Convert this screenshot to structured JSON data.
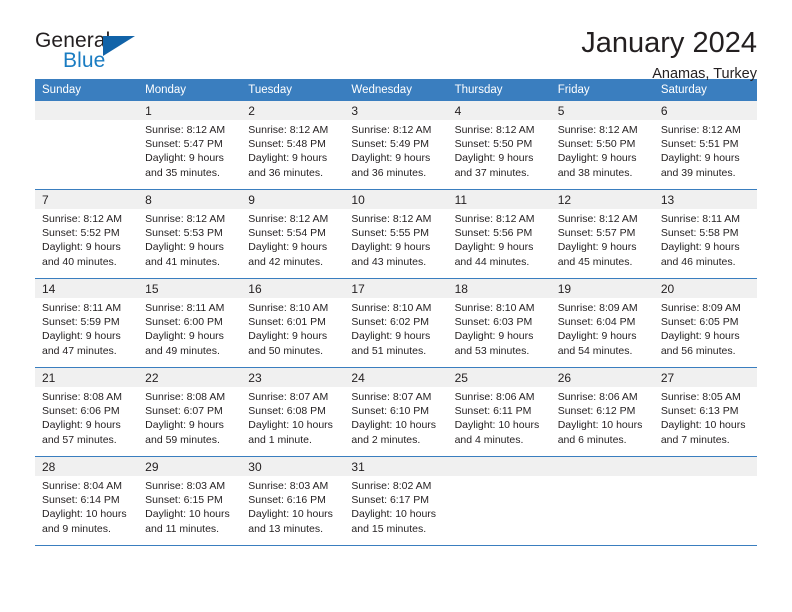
{
  "brand": {
    "name_part1": "General",
    "name_part2": "Blue",
    "accent_color": "#1163a8",
    "blue_text_color": "#1a7cc2"
  },
  "header": {
    "title": "January 2024",
    "subtitle": "Anamas, Turkey",
    "header_bg_color": "#3a7ebf",
    "daynum_bg_color": "#f0f0f0"
  },
  "weekdays": [
    "Sunday",
    "Monday",
    "Tuesday",
    "Wednesday",
    "Thursday",
    "Friday",
    "Saturday"
  ],
  "weeks": [
    {
      "days": [
        {
          "num": "",
          "sunrise": "",
          "sunset": "",
          "daylight1": "",
          "daylight2": "",
          "empty": true
        },
        {
          "num": "1",
          "sunrise": "Sunrise: 8:12 AM",
          "sunset": "Sunset: 5:47 PM",
          "daylight1": "Daylight: 9 hours",
          "daylight2": "and 35 minutes."
        },
        {
          "num": "2",
          "sunrise": "Sunrise: 8:12 AM",
          "sunset": "Sunset: 5:48 PM",
          "daylight1": "Daylight: 9 hours",
          "daylight2": "and 36 minutes."
        },
        {
          "num": "3",
          "sunrise": "Sunrise: 8:12 AM",
          "sunset": "Sunset: 5:49 PM",
          "daylight1": "Daylight: 9 hours",
          "daylight2": "and 36 minutes."
        },
        {
          "num": "4",
          "sunrise": "Sunrise: 8:12 AM",
          "sunset": "Sunset: 5:50 PM",
          "daylight1": "Daylight: 9 hours",
          "daylight2": "and 37 minutes."
        },
        {
          "num": "5",
          "sunrise": "Sunrise: 8:12 AM",
          "sunset": "Sunset: 5:50 PM",
          "daylight1": "Daylight: 9 hours",
          "daylight2": "and 38 minutes."
        },
        {
          "num": "6",
          "sunrise": "Sunrise: 8:12 AM",
          "sunset": "Sunset: 5:51 PM",
          "daylight1": "Daylight: 9 hours",
          "daylight2": "and 39 minutes."
        }
      ]
    },
    {
      "days": [
        {
          "num": "7",
          "sunrise": "Sunrise: 8:12 AM",
          "sunset": "Sunset: 5:52 PM",
          "daylight1": "Daylight: 9 hours",
          "daylight2": "and 40 minutes."
        },
        {
          "num": "8",
          "sunrise": "Sunrise: 8:12 AM",
          "sunset": "Sunset: 5:53 PM",
          "daylight1": "Daylight: 9 hours",
          "daylight2": "and 41 minutes."
        },
        {
          "num": "9",
          "sunrise": "Sunrise: 8:12 AM",
          "sunset": "Sunset: 5:54 PM",
          "daylight1": "Daylight: 9 hours",
          "daylight2": "and 42 minutes."
        },
        {
          "num": "10",
          "sunrise": "Sunrise: 8:12 AM",
          "sunset": "Sunset: 5:55 PM",
          "daylight1": "Daylight: 9 hours",
          "daylight2": "and 43 minutes."
        },
        {
          "num": "11",
          "sunrise": "Sunrise: 8:12 AM",
          "sunset": "Sunset: 5:56 PM",
          "daylight1": "Daylight: 9 hours",
          "daylight2": "and 44 minutes."
        },
        {
          "num": "12",
          "sunrise": "Sunrise: 8:12 AM",
          "sunset": "Sunset: 5:57 PM",
          "daylight1": "Daylight: 9 hours",
          "daylight2": "and 45 minutes."
        },
        {
          "num": "13",
          "sunrise": "Sunrise: 8:11 AM",
          "sunset": "Sunset: 5:58 PM",
          "daylight1": "Daylight: 9 hours",
          "daylight2": "and 46 minutes."
        }
      ]
    },
    {
      "days": [
        {
          "num": "14",
          "sunrise": "Sunrise: 8:11 AM",
          "sunset": "Sunset: 5:59 PM",
          "daylight1": "Daylight: 9 hours",
          "daylight2": "and 47 minutes."
        },
        {
          "num": "15",
          "sunrise": "Sunrise: 8:11 AM",
          "sunset": "Sunset: 6:00 PM",
          "daylight1": "Daylight: 9 hours",
          "daylight2": "and 49 minutes."
        },
        {
          "num": "16",
          "sunrise": "Sunrise: 8:10 AM",
          "sunset": "Sunset: 6:01 PM",
          "daylight1": "Daylight: 9 hours",
          "daylight2": "and 50 minutes."
        },
        {
          "num": "17",
          "sunrise": "Sunrise: 8:10 AM",
          "sunset": "Sunset: 6:02 PM",
          "daylight1": "Daylight: 9 hours",
          "daylight2": "and 51 minutes."
        },
        {
          "num": "18",
          "sunrise": "Sunrise: 8:10 AM",
          "sunset": "Sunset: 6:03 PM",
          "daylight1": "Daylight: 9 hours",
          "daylight2": "and 53 minutes."
        },
        {
          "num": "19",
          "sunrise": "Sunrise: 8:09 AM",
          "sunset": "Sunset: 6:04 PM",
          "daylight1": "Daylight: 9 hours",
          "daylight2": "and 54 minutes."
        },
        {
          "num": "20",
          "sunrise": "Sunrise: 8:09 AM",
          "sunset": "Sunset: 6:05 PM",
          "daylight1": "Daylight: 9 hours",
          "daylight2": "and 56 minutes."
        }
      ]
    },
    {
      "days": [
        {
          "num": "21",
          "sunrise": "Sunrise: 8:08 AM",
          "sunset": "Sunset: 6:06 PM",
          "daylight1": "Daylight: 9 hours",
          "daylight2": "and 57 minutes."
        },
        {
          "num": "22",
          "sunrise": "Sunrise: 8:08 AM",
          "sunset": "Sunset: 6:07 PM",
          "daylight1": "Daylight: 9 hours",
          "daylight2": "and 59 minutes."
        },
        {
          "num": "23",
          "sunrise": "Sunrise: 8:07 AM",
          "sunset": "Sunset: 6:08 PM",
          "daylight1": "Daylight: 10 hours",
          "daylight2": "and 1 minute."
        },
        {
          "num": "24",
          "sunrise": "Sunrise: 8:07 AM",
          "sunset": "Sunset: 6:10 PM",
          "daylight1": "Daylight: 10 hours",
          "daylight2": "and 2 minutes."
        },
        {
          "num": "25",
          "sunrise": "Sunrise: 8:06 AM",
          "sunset": "Sunset: 6:11 PM",
          "daylight1": "Daylight: 10 hours",
          "daylight2": "and 4 minutes."
        },
        {
          "num": "26",
          "sunrise": "Sunrise: 8:06 AM",
          "sunset": "Sunset: 6:12 PM",
          "daylight1": "Daylight: 10 hours",
          "daylight2": "and 6 minutes."
        },
        {
          "num": "27",
          "sunrise": "Sunrise: 8:05 AM",
          "sunset": "Sunset: 6:13 PM",
          "daylight1": "Daylight: 10 hours",
          "daylight2": "and 7 minutes."
        }
      ]
    },
    {
      "days": [
        {
          "num": "28",
          "sunrise": "Sunrise: 8:04 AM",
          "sunset": "Sunset: 6:14 PM",
          "daylight1": "Daylight: 10 hours",
          "daylight2": "and 9 minutes."
        },
        {
          "num": "29",
          "sunrise": "Sunrise: 8:03 AM",
          "sunset": "Sunset: 6:15 PM",
          "daylight1": "Daylight: 10 hours",
          "daylight2": "and 11 minutes."
        },
        {
          "num": "30",
          "sunrise": "Sunrise: 8:03 AM",
          "sunset": "Sunset: 6:16 PM",
          "daylight1": "Daylight: 10 hours",
          "daylight2": "and 13 minutes."
        },
        {
          "num": "31",
          "sunrise": "Sunrise: 8:02 AM",
          "sunset": "Sunset: 6:17 PM",
          "daylight1": "Daylight: 10 hours",
          "daylight2": "and 15 minutes."
        },
        {
          "num": "",
          "sunrise": "",
          "sunset": "",
          "daylight1": "",
          "daylight2": "",
          "empty": true
        },
        {
          "num": "",
          "sunrise": "",
          "sunset": "",
          "daylight1": "",
          "daylight2": "",
          "empty": true
        },
        {
          "num": "",
          "sunrise": "",
          "sunset": "",
          "daylight1": "",
          "daylight2": "",
          "empty": true
        }
      ]
    }
  ]
}
